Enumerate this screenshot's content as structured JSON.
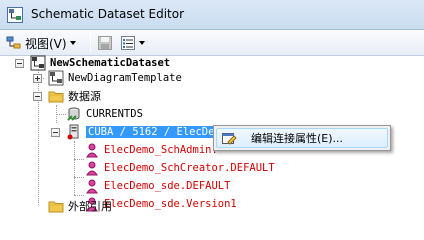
{
  "window": {
    "title": "Schematic Dataset Editor"
  },
  "toolbar": {
    "view_label": "视图(V)"
  },
  "tree": {
    "root": "NewSchematicDataset",
    "items": [
      {
        "label": "NewDiagramTemplate"
      },
      {
        "label": "数据源"
      },
      {
        "label": "CURRENTDS"
      },
      {
        "label": "CUBA / 5162 / ElecDem"
      },
      {
        "label": "ElecDemo_SchAdmin."
      },
      {
        "label": "ElecDemo_SchCreator.DEFAULT"
      },
      {
        "label": "ElecDemo_sde.DEFAULT"
      },
      {
        "label": "ElecDemo_sde.Version1"
      },
      {
        "label": "外部引用"
      }
    ]
  },
  "context_menu": {
    "items": [
      {
        "label": "编辑连接属性(E)..."
      }
    ]
  },
  "colors": {
    "selection": "#3399ff",
    "version_text": "#d40000",
    "folder": "#f2c94c"
  }
}
